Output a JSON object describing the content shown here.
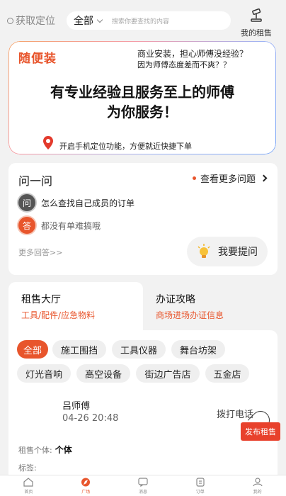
{
  "header": {
    "location_label": "获取定位",
    "category": "全部",
    "search_placeholder": "搜索你要查找的内容",
    "my_rent_label": "我的租售"
  },
  "banner": {
    "brand": "随便装",
    "question_line1": "商业安装，担心师傅没经验？",
    "question_line2": "因为师傅态度差而不爽？？",
    "headline_line1": "有专业经验且服务至上的师傅",
    "headline_line2": "为你服务！",
    "tip": "开启手机定位功能，方便就近快捷下单"
  },
  "qa": {
    "title": "问一问",
    "more_link": "查看更多问题",
    "question_badge": "问",
    "question": "怎么查找自己成员的订单",
    "answer_badge": "答",
    "answer": "都没有单难搞哦",
    "more_answers": "更多回答>>",
    "ask_button": "我要提问"
  },
  "tabs": [
    {
      "title": "租售大厅",
      "subtitle": "工具/配件/应急物料"
    },
    {
      "title": "办证攻略",
      "subtitle": "商场进场办证信息"
    }
  ],
  "chips": [
    "全部",
    "施工围挡",
    "工具仪器",
    "舞台坊架",
    "灯光音响",
    "高空设备",
    "街边广告店",
    "五金店"
  ],
  "listing": {
    "name": "吕师傅",
    "time": "04-26 20:48",
    "call": "拨打电话",
    "field1_label": "租售个体:",
    "field1_value": "个体",
    "field2_label": "标签:"
  },
  "publish_label": "发布租售",
  "nav": [
    {
      "label": "首页",
      "icon": "home-icon"
    },
    {
      "label": "广场",
      "icon": "compass-icon"
    },
    {
      "label": "消息",
      "icon": "message-icon"
    },
    {
      "label": "订单",
      "icon": "order-icon"
    },
    {
      "label": "我的",
      "icon": "user-icon"
    }
  ],
  "colors": {
    "accent": "#e8552c",
    "background": "#f2f2f2"
  }
}
